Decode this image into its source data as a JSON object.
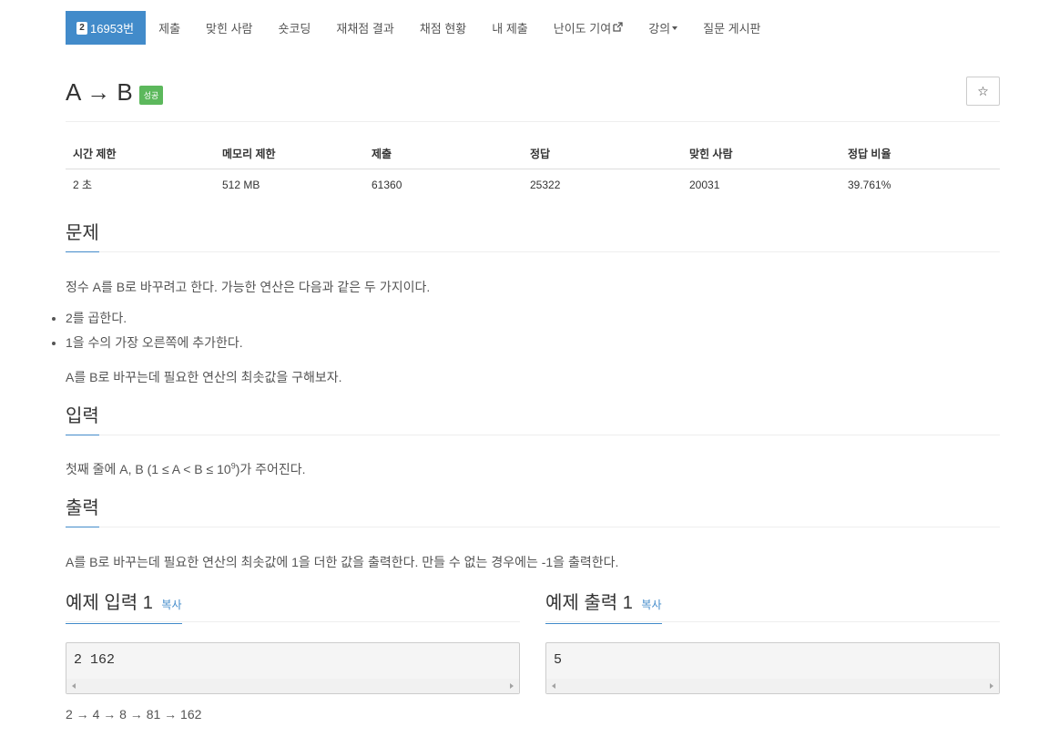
{
  "nav": {
    "problem_number": "16953번",
    "badge": "2",
    "items": [
      "제출",
      "맞힌 사람",
      "숏코딩",
      "재채점 결과",
      "채점 현황",
      "내 제출",
      "난이도 기여",
      "강의",
      "질문 게시판"
    ]
  },
  "problem": {
    "title": "A → B",
    "status_label": "성공",
    "star_icon": "☆"
  },
  "info": {
    "headers": [
      "시간 제한",
      "메모리 제한",
      "제출",
      "정답",
      "맞힌 사람",
      "정답 비율"
    ],
    "values": [
      "2 초",
      "512 MB",
      "61360",
      "25322",
      "20031",
      "39.761%"
    ]
  },
  "sections": {
    "problem_title": "문제",
    "problem_text": "정수 A를 B로 바꾸려고 한다. 가능한 연산은 다음과 같은 두 가지이다.",
    "ops": [
      "2를 곱한다.",
      "1을 수의 가장 오른쪽에 추가한다."
    ],
    "problem_text2": "A를 B로 바꾸는데 필요한 연산의 최솟값을 구해보자.",
    "input_title": "입력",
    "input_text_pre": "첫째 줄에 A, B (1 ≤ A < B ≤ 10",
    "input_text_sup": "9",
    "input_text_post": ")가 주어진다.",
    "output_title": "출력",
    "output_text": "A를 B로 바꾸는데 필요한 연산의 최솟값에 1을 더한 값을 출력한다. 만들 수 없는 경우에는 -1을 출력한다."
  },
  "samples": {
    "input_title": "예제 입력 1",
    "output_title": "예제 출력 1",
    "copy_label": "복사",
    "input_value": "2 162",
    "output_value": "5",
    "explanation": "2 → 4 → 8 → 81 → 162"
  }
}
